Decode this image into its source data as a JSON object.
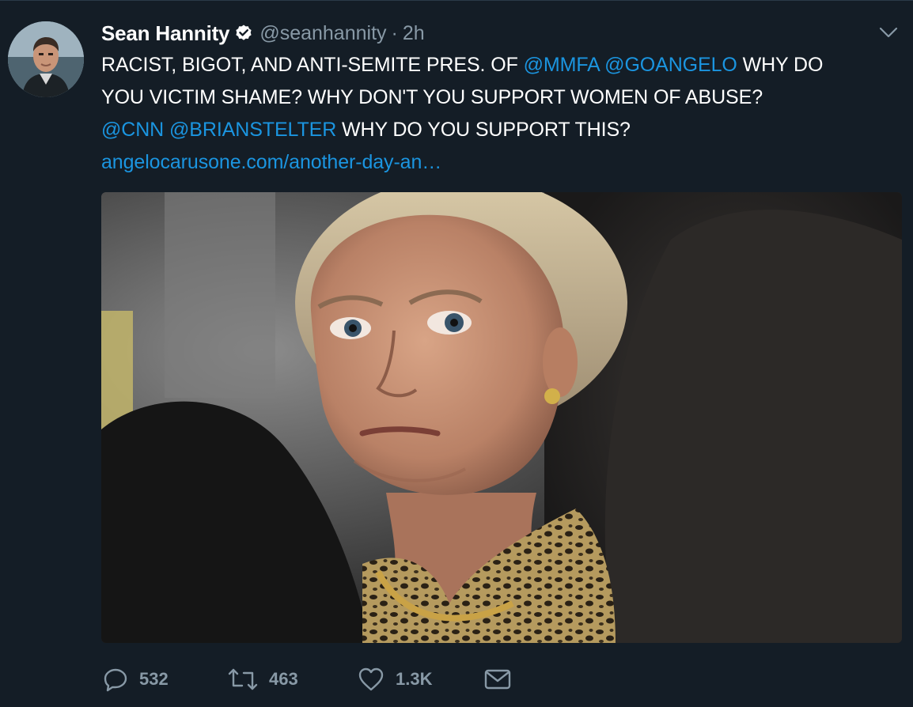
{
  "tweet": {
    "author_name": "Sean Hannity",
    "verified_icon": "verified-badge-icon",
    "handle": "@seanhannity",
    "separator": "·",
    "time": "2h",
    "text": {
      "line1": {
        "t1": "RACIST, BIGOT, AND ANTI-SEMITE PRES. OF ",
        "m1": "@MMFA",
        "s1": " ",
        "m2": "@GOANGELO",
        "t2": " WHY DO"
      },
      "line2": {
        "t1": "YOU VICTIM SHAME? WHY DON'T YOU SUPPORT WOMEN OF ABUSE?"
      },
      "line3": {
        "m1": "@CNN",
        "s1": " ",
        "m2": "@BRIANSTELTER",
        "t1": " WHY DO YOU SUPPORT THIS?"
      },
      "link": "angelocarusone.com/another-day-an…"
    },
    "actions": {
      "reply_count": "532",
      "retweet_count": "463",
      "like_count": "1.3K"
    }
  },
  "colors": {
    "background": "#141d26",
    "text": "#ffffff",
    "secondary": "#8899a6",
    "link": "#1b95e0"
  }
}
